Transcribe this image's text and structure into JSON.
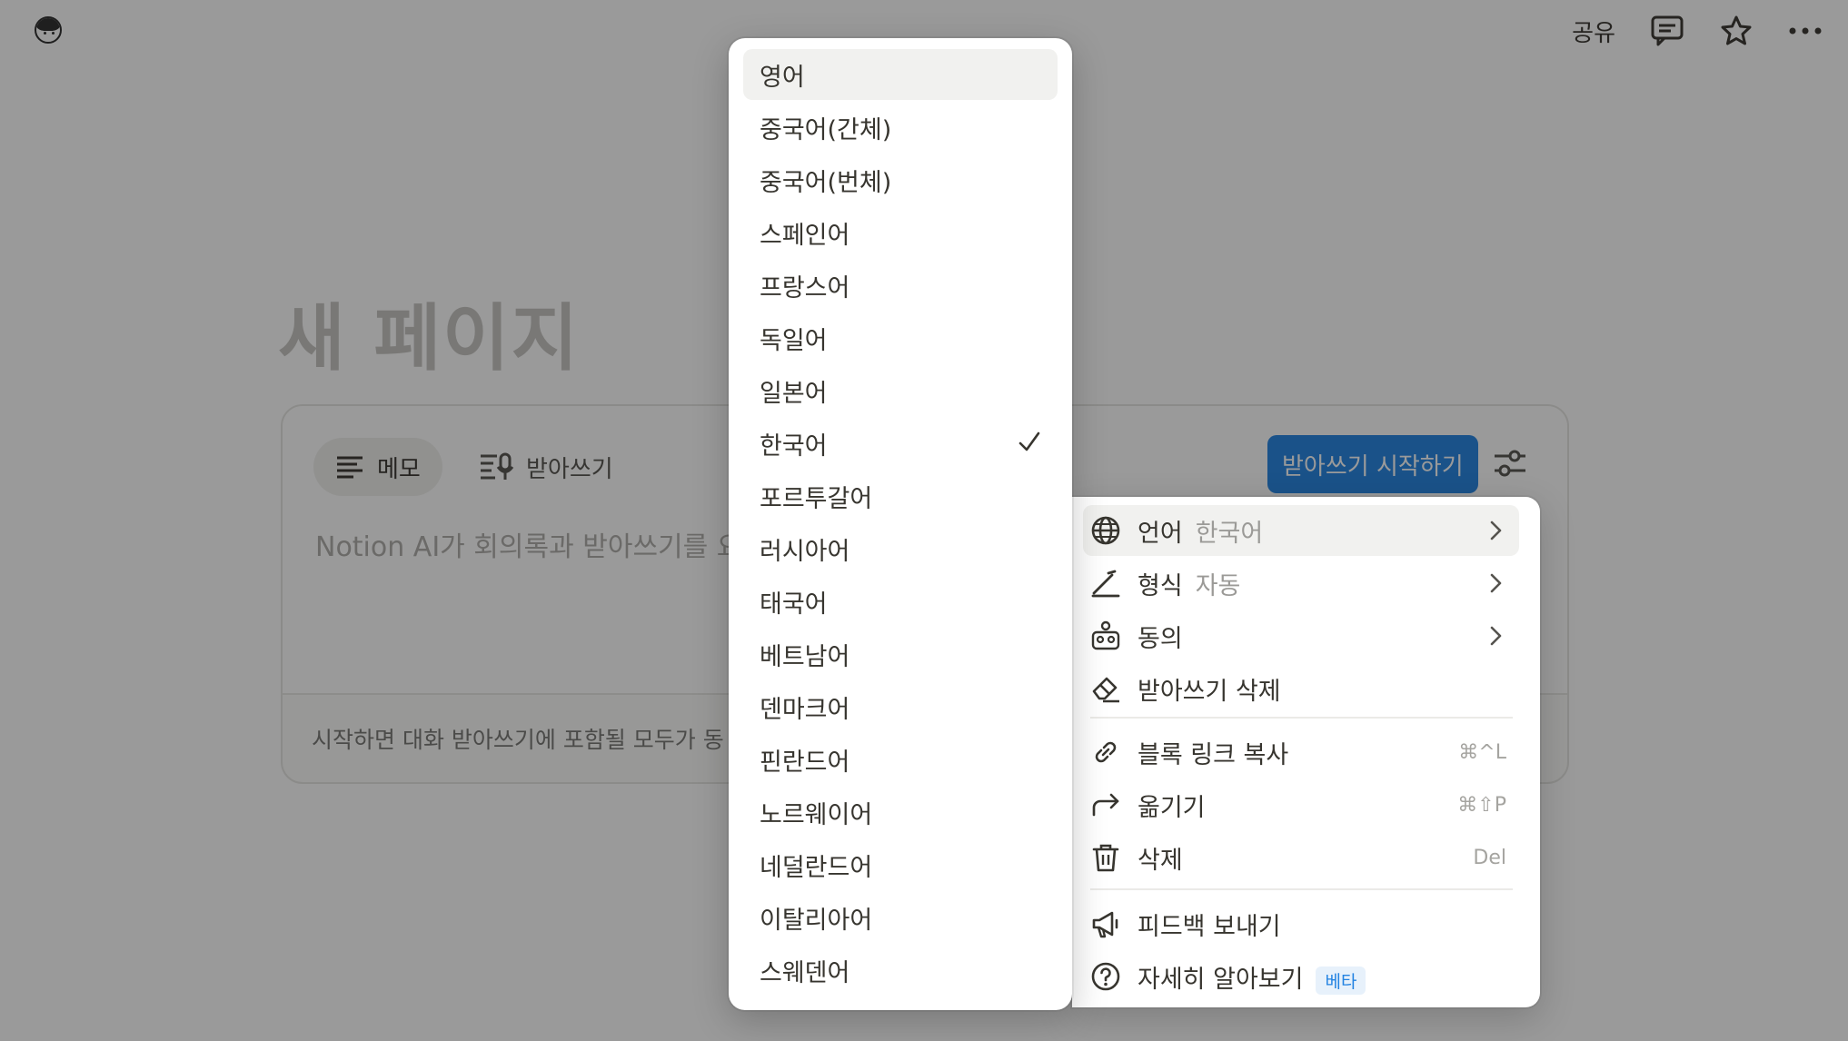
{
  "topbar": {
    "share_label": "공유",
    "icons": [
      "comment-icon",
      "star-icon",
      "more-icon"
    ]
  },
  "page": {
    "title": "새 페이지"
  },
  "meeting": {
    "tab_memo": "메모",
    "tab_transcript": "받아쓰기",
    "start_button": "받아쓰기 시작하기",
    "placeholder": "Notion AI가 회의록과 받아쓰기를 요",
    "consent_text": "시작하면 대화 받아쓰기에 포함될 모두가 동"
  },
  "language_menu": {
    "selected": "한국어",
    "items": [
      "영어",
      "중국어(간체)",
      "중국어(번체)",
      "스페인어",
      "프랑스어",
      "독일어",
      "일본어",
      "한국어",
      "포르투갈어",
      "러시아어",
      "태국어",
      "베트남어",
      "덴마크어",
      "핀란드어",
      "노르웨이어",
      "네덜란드어",
      "이탈리아어",
      "스웨덴어"
    ]
  },
  "block_menu": {
    "language": {
      "label": "언어",
      "value": "한국어"
    },
    "format": {
      "label": "형식",
      "value": "자동"
    },
    "consent": {
      "label": "동의"
    },
    "delete_transcript": {
      "label": "받아쓰기 삭제"
    },
    "copy_link": {
      "label": "블록 링크 복사",
      "shortcut": "⌘^L"
    },
    "move": {
      "label": "옮기기",
      "shortcut": "⌘⇧P"
    },
    "delete": {
      "label": "삭제",
      "shortcut": "Del"
    },
    "feedback": {
      "label": "피드백 보내기"
    },
    "learn_more": {
      "label": "자세히 알아보기",
      "badge": "베타"
    }
  },
  "colors": {
    "accent": "#2383e2",
    "text": "#37352f",
    "muted": "#9b9a97",
    "overlay": "rgba(15,15,15,0.42)"
  }
}
